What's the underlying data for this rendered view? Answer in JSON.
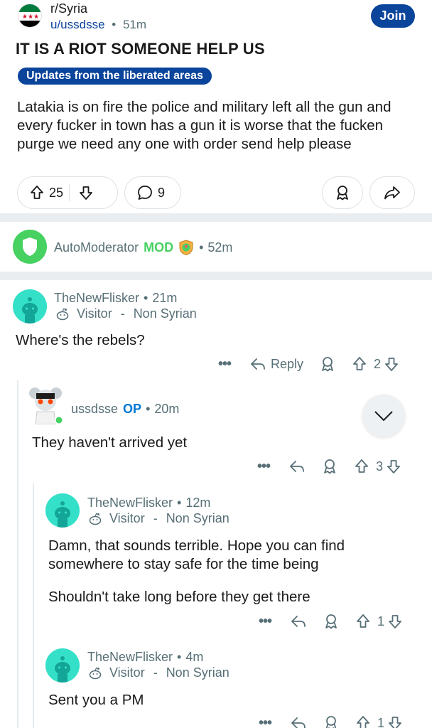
{
  "header": {
    "subreddit": "r/Syria",
    "author": "u/ussdsse",
    "time": "51m",
    "join_label": "Join",
    "sep": "•"
  },
  "post": {
    "title": "IT IS A RIOT SOMEONE HELP US",
    "flair": "Updates from the liberated areas",
    "body": "Latakia is on fire the police and military left all the gun and every fucker in town has a gun it is worse  that the fucken purge we need any one with order send help please",
    "votes": "25",
    "comments": "9"
  },
  "automod": {
    "name": "AutoModerator",
    "mod_tag": "MOD",
    "time": "52m"
  },
  "comments": [
    {
      "author": "TheNewFlisker",
      "time": "21m",
      "flair_a": "Visitor",
      "flair_dash": "-",
      "flair_b": "Non Syrian",
      "body": "Where's the rebels?",
      "reply_label": "Reply",
      "votes": "2",
      "dots": "•••"
    },
    {
      "author": "ussdsse",
      "op_tag": "OP",
      "time": "20m",
      "body": "They haven't arrived yet",
      "votes": "3",
      "dots": "•••"
    },
    {
      "author": "TheNewFlisker",
      "time": "12m",
      "flair_a": "Visitor",
      "flair_dash": "-",
      "flair_b": "Non Syrian",
      "body_p1": "Damn, that sounds terrible. Hope you can find somewhere to stay safe for the time being",
      "body_p2": "Shouldn't take long before they get there",
      "votes": "1",
      "dots": "•••"
    },
    {
      "author": "TheNewFlisker",
      "time": "4m",
      "flair_a": "Visitor",
      "flair_dash": "-",
      "flair_b": "Non Syrian",
      "body": "Sent you a PM",
      "votes": "1",
      "dots": "•••"
    }
  ],
  "colors": {
    "accent": "#0a449b",
    "mod_green": "#46d160",
    "op_blue": "#0079d3",
    "avatar_teal": "#35e0c8"
  }
}
